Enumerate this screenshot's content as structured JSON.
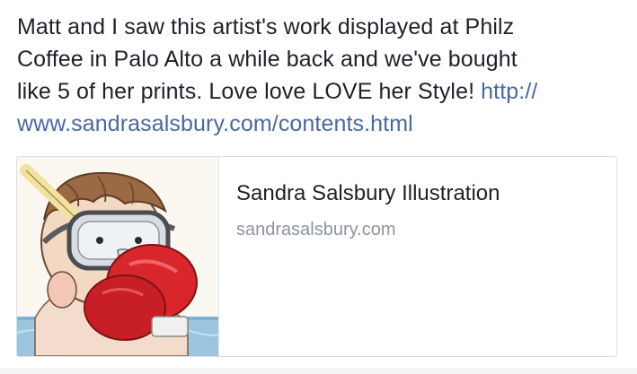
{
  "post": {
    "lines": [
      "Matt and I saw this artist's work displayed at Philz",
      "Coffee in Palo Alto a while back and we've bought",
      "like 5 of her prints. Love love LOVE her Style!"
    ],
    "link_part1": "http://",
    "link_part2": "www.sandrasalsbury.com/contents.html"
  },
  "link_preview": {
    "title": "Sandra Salsbury Illustration",
    "domain": "sandrasalsbury.com",
    "image_icon": "illustration-thumbnail"
  },
  "colors": {
    "text": "#1d2129",
    "link": "#4b67a1",
    "muted": "#90949c",
    "border": "#dddfe2",
    "glove": "#d8262c",
    "water": "#9cc6df"
  }
}
